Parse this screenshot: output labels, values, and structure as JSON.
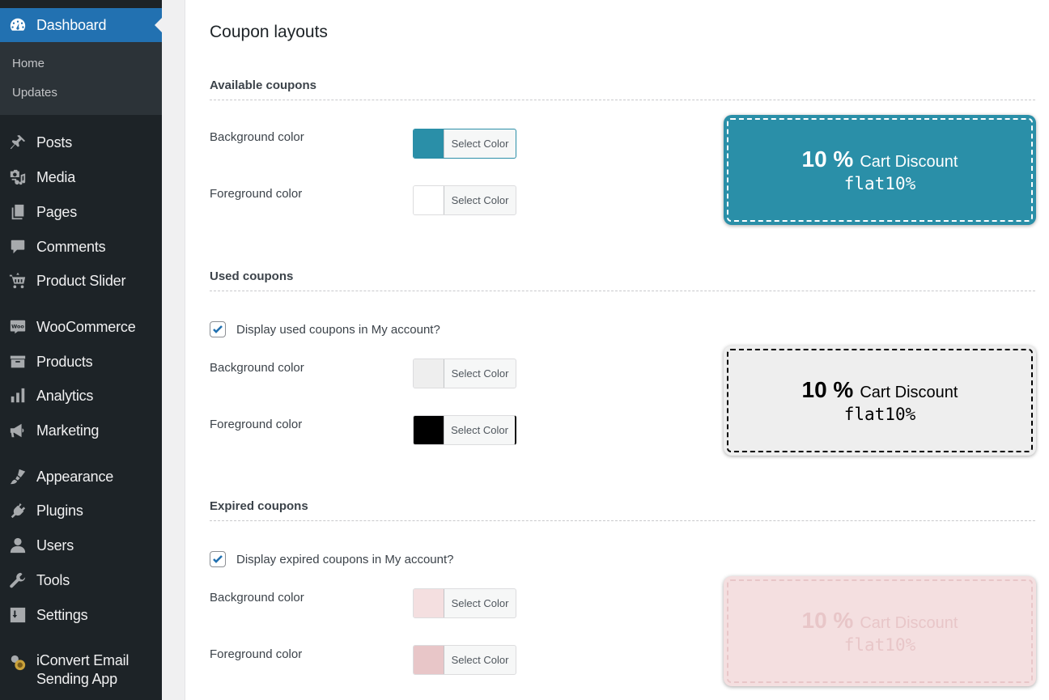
{
  "sidebar": {
    "active": {
      "label": "Dashboard",
      "icon": "dashboard-icon"
    },
    "submenu": [
      {
        "label": "Home"
      },
      {
        "label": "Updates"
      }
    ],
    "items": [
      {
        "label": "Posts",
        "icon": "pin-icon"
      },
      {
        "label": "Media",
        "icon": "media-icon"
      },
      {
        "label": "Pages",
        "icon": "pages-icon"
      },
      {
        "label": "Comments",
        "icon": "comment-icon"
      },
      {
        "label": "Product Slider",
        "icon": "cart-icon"
      },
      {
        "label": "WooCommerce",
        "icon": "woo-icon"
      },
      {
        "label": "Products",
        "icon": "archive-icon"
      },
      {
        "label": "Analytics",
        "icon": "bar-chart-icon"
      },
      {
        "label": "Marketing",
        "icon": "megaphone-icon"
      },
      {
        "label": "Appearance",
        "icon": "paintbrush-icon"
      },
      {
        "label": "Plugins",
        "icon": "plug-icon"
      },
      {
        "label": "Users",
        "icon": "user-icon"
      },
      {
        "label": "Tools",
        "icon": "wrench-icon"
      },
      {
        "label": "Settings",
        "icon": "sliders-icon"
      },
      {
        "label": "iConvert Email Sending App",
        "line1": "iConvert Email",
        "line2": "Sending App",
        "icon": "iconvert-gear-icon"
      }
    ]
  },
  "main": {
    "title": "Coupon layouts",
    "select_color_label": "Select Color",
    "sections": [
      {
        "title": "Available coupons",
        "background_label": "Background color",
        "foreground_label": "Foreground color",
        "background_color": "#2a8fa8",
        "foreground_color": "#ffffff",
        "preview": {
          "amount": "10 %",
          "type": "Cart Discount",
          "code": "flat10%"
        }
      },
      {
        "title": "Used coupons",
        "checkbox_label": "Display used coupons in My account?",
        "checked": true,
        "background_label": "Background color",
        "foreground_label": "Foreground color",
        "background_color": "#eeeeee",
        "foreground_color": "#000000",
        "preview": {
          "amount": "10 %",
          "type": "Cart Discount",
          "code": "flat10%"
        }
      },
      {
        "title": "Expired coupons",
        "checkbox_label": "Display expired coupons in My account?",
        "checked": true,
        "background_label": "Background color",
        "foreground_label": "Foreground color",
        "background_color": "#f4dfe0",
        "foreground_color": "#e8c6c8",
        "preview": {
          "amount": "10 %",
          "type": "Cart Discount",
          "code": "flat10%"
        }
      }
    ]
  },
  "colors": {
    "sidebar_bg": "#1d2327",
    "sidebar_active": "#2271b1",
    "checkbox_accent": "#2271b1"
  }
}
